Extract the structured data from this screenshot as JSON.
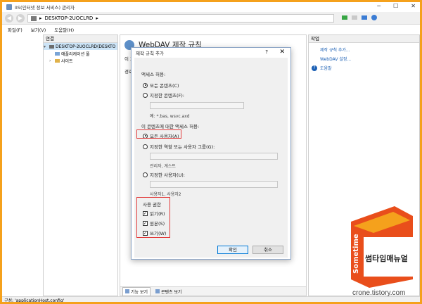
{
  "window": {
    "title": "IIS(인터넷 정보 서비스) 관리자",
    "controls": {
      "minimize": "─",
      "maximize": "☐",
      "close": "✕"
    }
  },
  "address": {
    "path": "DESKTOP-2UOCLRD",
    "chevron": "▸"
  },
  "menu": [
    "파일(F)",
    "보기(V)",
    "도움말(H)"
  ],
  "connections": {
    "header": "연결",
    "tree": [
      {
        "label": "DESKTOP-2UOCLRD(DESKTO",
        "level": 0
      },
      {
        "label": "애플리케이션 풀",
        "level": 1
      },
      {
        "label": "사이트",
        "level": 1
      }
    ]
  },
  "center": {
    "title": "WebDAV 제작 규칙",
    "partial_text_1": "이 기",
    "partial_text_2": "경로",
    "tabs": [
      "기능 보기",
      "콘텐츠 보기"
    ]
  },
  "actions": {
    "header": "작업",
    "items": [
      "제작 규칙 추가...",
      "WebDAV 설정...",
      "도움말"
    ]
  },
  "status": "구성: 'applicationHost.config'",
  "dialog": {
    "title": "제작 규칙 추가",
    "help": "?",
    "close": "✕",
    "access_label": "액세스 허용:",
    "all_content": "모든 콘텐츠(C)",
    "specified_content": "지정한 콘텐츠(F):",
    "content_example": "예: *.bas, wsvc.axd",
    "allow_access_label": "이 콘텐츠에 대한 액세스 허용:",
    "all_users": "모든 사용자(A)",
    "specified_roles": "지정한 역할 또는 사용자 그룹(G):",
    "roles_example": "관리자, 게스트",
    "specified_users": "지정한 사용자(U):",
    "users_example": "사용자1, 사용자2",
    "permissions_label": "사용 권한",
    "read": "읽기(R)",
    "source": "원본(S)",
    "write": "쓰기(W)",
    "ok": "확인",
    "cancel": "취소"
  },
  "watermark": {
    "title": "썸타임매뉴얼",
    "vertical": "Sometime",
    "site": "crone.tistory.com"
  },
  "colors": {
    "frame_border": "#f5a11c",
    "highlight_red": "#e23b3b",
    "link_blue": "#1a5fb4"
  }
}
